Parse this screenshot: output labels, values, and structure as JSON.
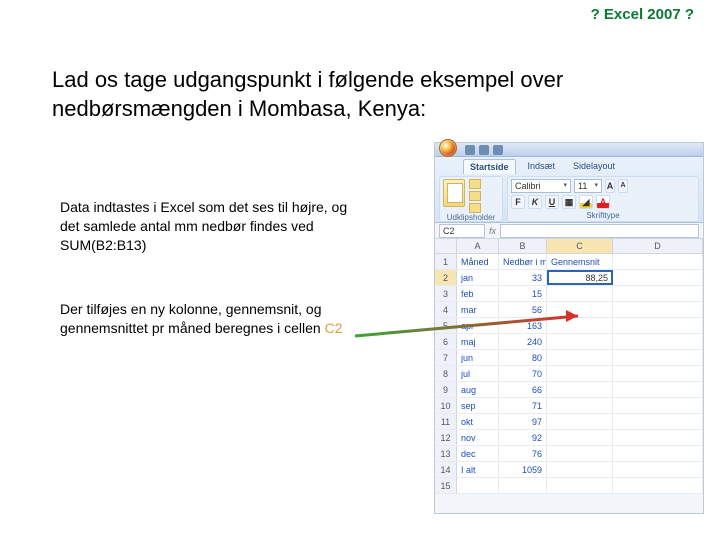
{
  "title_bar": "? Excel 2007 ?",
  "heading": "Lad os tage udgangspunkt i følgende eksempel over nedbørsmængden i Mombasa, Kenya:",
  "para1": "Data indtastes i Excel som det ses til højre,\nog det samlede antal mm nedbør findes ved SUM(B2:B13)",
  "para2_pre": "Der tilføjes en ny kolonne, gennemsnit, og gennemsnittet pr måned beregnes i cellen ",
  "para2_cell": "C2",
  "excel": {
    "tabs": {
      "home": "Startside",
      "insert": "Indsæt",
      "layout": "Sidelayout"
    },
    "ribbon": {
      "clipboard_label": "Udklipsholder",
      "paste_label": "Sæt ind",
      "font_label": "Skrifttype",
      "font_name": "Calibri",
      "font_size": "11",
      "bold": "F",
      "italic": "K",
      "underline": "U"
    },
    "cols": {
      "A": "A",
      "B": "B",
      "C": "C",
      "D": "D"
    },
    "name_box": "C2",
    "headers": {
      "A": "Måned",
      "B": "Nedbør i mm",
      "C": "Gennemsnit"
    },
    "rows": [
      {
        "n": "1"
      },
      {
        "n": "2",
        "m": "jan",
        "mm": "33",
        "avg": "88,25"
      },
      {
        "n": "3",
        "m": "feb",
        "mm": "15"
      },
      {
        "n": "4",
        "m": "mar",
        "mm": "56"
      },
      {
        "n": "5",
        "m": "apr",
        "mm": "163"
      },
      {
        "n": "6",
        "m": "maj",
        "mm": "240"
      },
      {
        "n": "7",
        "m": "jun",
        "mm": "80"
      },
      {
        "n": "8",
        "m": "jul",
        "mm": "70"
      },
      {
        "n": "9",
        "m": "aug",
        "mm": "66"
      },
      {
        "n": "10",
        "m": "sep",
        "mm": "71"
      },
      {
        "n": "11",
        "m": "okt",
        "mm": "97"
      },
      {
        "n": "12",
        "m": "nov",
        "mm": "92"
      },
      {
        "n": "13",
        "m": "dec",
        "mm": "76"
      },
      {
        "n": "14",
        "m": "I alt",
        "mm": "1059"
      },
      {
        "n": "15"
      }
    ]
  }
}
